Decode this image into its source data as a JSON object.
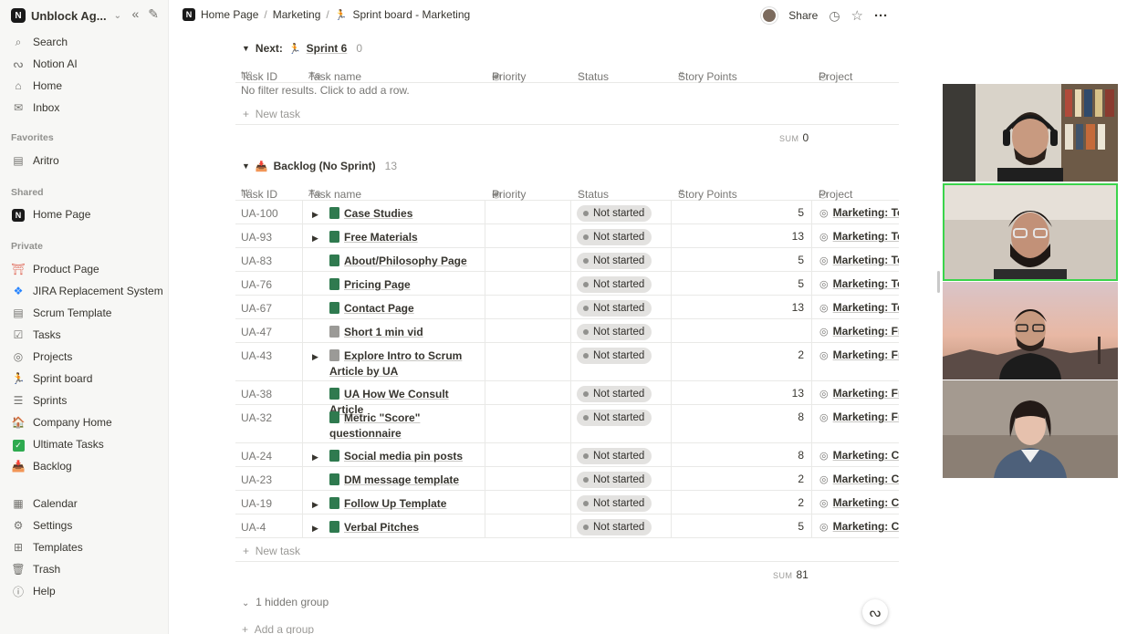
{
  "sidebar": {
    "workspace": "Unblock Ag...",
    "top_items": [
      {
        "label": "Search",
        "icon": "search-icon"
      },
      {
        "label": "Notion AI",
        "icon": "notion-ai-icon"
      },
      {
        "label": "Home",
        "icon": "home-icon"
      },
      {
        "label": "Inbox",
        "icon": "inbox-icon"
      }
    ],
    "favorites_label": "Favorites",
    "favorites": [
      {
        "label": "Aritro"
      }
    ],
    "shared_label": "Shared",
    "shared": [
      {
        "label": "Home Page"
      }
    ],
    "private_label": "Private",
    "private": [
      {
        "label": "Product Page"
      },
      {
        "label": "JIRA Replacement System"
      },
      {
        "label": "Scrum Template"
      },
      {
        "label": "Tasks"
      },
      {
        "label": "Projects"
      },
      {
        "label": "Sprint board"
      },
      {
        "label": "Sprints"
      },
      {
        "label": "Company Home"
      },
      {
        "label": "Ultimate Tasks"
      },
      {
        "label": "Backlog"
      }
    ],
    "bottom": [
      {
        "label": "Calendar"
      },
      {
        "label": "Settings"
      },
      {
        "label": "Templates"
      },
      {
        "label": "Trash"
      },
      {
        "label": "Help"
      }
    ]
  },
  "topbar": {
    "crumb1": "Home Page",
    "crumb2": "Marketing",
    "crumb3": "Sprint board - Marketing",
    "share": "Share"
  },
  "columns": {
    "id": "Task ID",
    "name": "Task name",
    "priority": "Priority",
    "status": "Status",
    "points": "Story Points",
    "project": "Project",
    "id_prefix": "Nº",
    "name_prefix": "Aa"
  },
  "next_group": {
    "label": "Next:",
    "sprint": "Sprint 6",
    "count": "0",
    "empty": "No filter results. Click to add a row.",
    "new_task": "New task",
    "sum_label": "SUM",
    "sum_value": "0"
  },
  "backlog_group": {
    "label": "Backlog (No Sprint)",
    "count": "13",
    "new_task": "New task",
    "sum_label": "SUM",
    "sum_value": "81",
    "rows": [
      {
        "id": "UA-100",
        "name": "Case Studies",
        "status": "Not started",
        "points": "5",
        "project": "Marketing: Te",
        "toggle": true,
        "icon": "doc"
      },
      {
        "id": "UA-93",
        "name": "Free Materials",
        "status": "Not started",
        "points": "13",
        "project": "Marketing: Te",
        "toggle": true,
        "icon": "doc"
      },
      {
        "id": "UA-83",
        "name": "About/Philosophy Page",
        "status": "Not started",
        "points": "5",
        "project": "Marketing: Te",
        "toggle": false,
        "icon": "doc"
      },
      {
        "id": "UA-76",
        "name": "Pricing Page",
        "status": "Not started",
        "points": "5",
        "project": "Marketing: Te",
        "toggle": false,
        "icon": "doc"
      },
      {
        "id": "UA-67",
        "name": "Contact Page",
        "status": "Not started",
        "points": "13",
        "project": "Marketing: Te",
        "toggle": false,
        "icon": "doc"
      },
      {
        "id": "UA-47",
        "name": "Short 1 min vid",
        "status": "Not started",
        "points": "",
        "project": "Marketing: Fre",
        "toggle": false,
        "icon": "grey"
      },
      {
        "id": "UA-43",
        "name": "Explore Intro to Scrum Article by UA",
        "status": "Not started",
        "points": "2",
        "project": "Marketing: Fre",
        "toggle": true,
        "icon": "grey",
        "tall": true
      },
      {
        "id": "UA-38",
        "name": "UA How We Consult Article",
        "status": "Not started",
        "points": "13",
        "project": "Marketing: Fre",
        "toggle": false,
        "icon": "doc"
      },
      {
        "id": "UA-32",
        "name": "Metric \"Score\" questionnaire",
        "status": "Not started",
        "points": "8",
        "project": "Marketing: Fre",
        "toggle": false,
        "icon": "doc",
        "tall": true
      },
      {
        "id": "UA-24",
        "name": "Social media pin posts",
        "status": "Not started",
        "points": "8",
        "project": "Marketing: Co",
        "toggle": true,
        "icon": "doc"
      },
      {
        "id": "UA-23",
        "name": "DM message template",
        "status": "Not started",
        "points": "2",
        "project": "Marketing: Co",
        "toggle": false,
        "icon": "doc"
      },
      {
        "id": "UA-19",
        "name": "Follow Up Template",
        "status": "Not started",
        "points": "2",
        "project": "Marketing: Co",
        "toggle": true,
        "icon": "doc"
      },
      {
        "id": "UA-4",
        "name": "Verbal Pitches",
        "status": "Not started",
        "points": "5",
        "project": "Marketing: Co",
        "toggle": true,
        "icon": "doc"
      }
    ]
  },
  "footer": {
    "hidden_group": "1 hidden group",
    "add_group": "Add a group"
  }
}
